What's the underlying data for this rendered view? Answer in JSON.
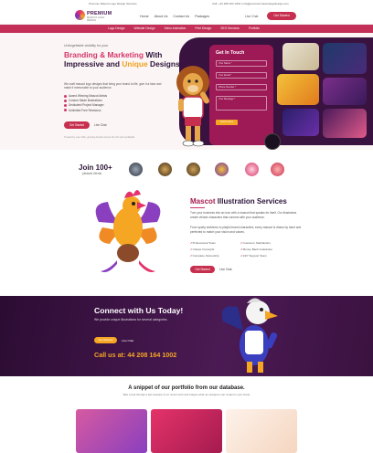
{
  "topbar": {
    "left": "Premium Mascot Logo Design Services",
    "right": "Call: +44 208 164 1002 | info@premiummascotlogodesign.com"
  },
  "header": {
    "logo_title": "PREMIUM",
    "logo_sub": "MASCOT LOGO DESIGN",
    "nav": [
      "Home",
      "About Us",
      "Contact Us",
      "Packages"
    ],
    "phone": "Live Chat",
    "cta": "Get Started"
  },
  "categories": [
    "Logo Design",
    "Website Design",
    "Video Animation",
    "Print Design",
    "SEO Services",
    "Portfolio"
  ],
  "hero": {
    "eyebrow": "Unforgettable visibility for your",
    "title_a": "Branding & Marketing",
    "title_b": "With Impressive and",
    "title_c": "Unique",
    "title_d": "Designs",
    "desc": "We craft mascot logo designs that bring your brand to life, give it a face and make it memorable to your audience.",
    "features": [
      "Award Winning Mascot Artists",
      "Custom Made Illustrations",
      "Dedicated Project Manager",
      "Unlimited Free Revisions"
    ],
    "cta": "Get Started",
    "cta2": "Live Chat",
    "foot": "Trusted by over 100+ growing brands across the UK and worldwide"
  },
  "form": {
    "title": "Get In Touch",
    "name_ph": "Your Name *",
    "email_ph": "Your Email *",
    "phone_ph": "Phone Number *",
    "msg_ph": "Your Message *",
    "send": "Submit Now"
  },
  "logos": {
    "title": "Join 100+",
    "sub": "pleased clients"
  },
  "mascot": {
    "title_a": "Mascot",
    "title_b": "Illustration Services",
    "p1": "Turn your business into an icon with a mascot that speaks for itself. Our illustrators create vibrant characters that connect with your audience.",
    "p2": "From sporty emblems to playful brand characters, every mascot is drawn by hand and perfected to match your vision and values.",
    "list": [
      "Professional Team",
      "Customer Satisfaction",
      "Unique Concepts",
      "Money Back Guarantee",
      "Complete Ownership",
      "24/7 Support Team"
    ],
    "cta": "Get Started",
    "cta2": "Live Chat"
  },
  "connect": {
    "title": "Connect with Us Today!",
    "desc": "We provide unique illustrations for several categories.",
    "b1": "Get Started",
    "b2": "Live Chat",
    "call": "Call us at: 44 208 164 1002"
  },
  "portfolio": {
    "title": "A snippet of our portfolio from our database.",
    "desc": "Take a look through a few samples of our recent work and imagine what our designers can create for your brand."
  },
  "colors": {
    "brand": "#c72f4f",
    "accent": "#f5a623",
    "dark": "#3a123f"
  }
}
